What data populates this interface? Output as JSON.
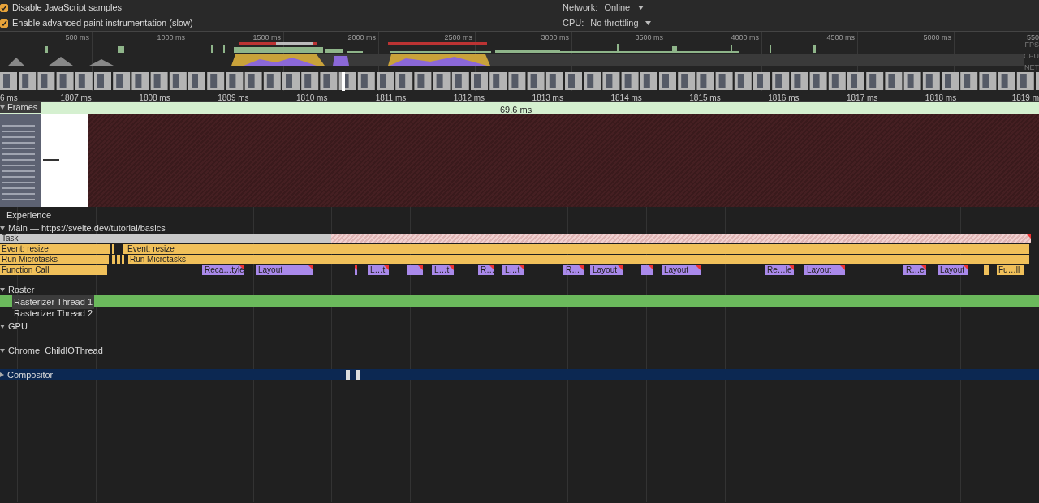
{
  "settings": {
    "checkboxes": [
      {
        "label": "Disable JavaScript samples",
        "checked": true
      },
      {
        "label": "Enable advanced paint instrumentation (slow)",
        "checked": true
      }
    ],
    "dropdowns": [
      {
        "label": "Network:",
        "value": "Online"
      },
      {
        "label": "CPU:",
        "value": "No throttling"
      }
    ]
  },
  "overview": {
    "ticks": [
      "500 ms",
      "1000 ms",
      "1500 ms",
      "2000 ms",
      "2500 ms",
      "3000 ms",
      "3500 ms",
      "4000 ms",
      "4500 ms",
      "5000 ms",
      "550"
    ],
    "lanes": [
      "FPS",
      "CPU",
      "NET"
    ]
  },
  "ruler": [
    "6 ms",
    "1807 ms",
    "1808 ms",
    "1809 ms",
    "1810 ms",
    "1811 ms",
    "1812 ms",
    "1813 ms",
    "1814 ms",
    "1815 ms",
    "1816 ms",
    "1817 ms",
    "1818 ms",
    "1819 m"
  ],
  "frames": {
    "label": "Frames",
    "expanded": true,
    "duration": "69.6 ms"
  },
  "experience": {
    "label": "Experience"
  },
  "main": {
    "label": "Main — https://svelte.dev/tutorial/basics",
    "expanded": true,
    "rows": [
      {
        "events": [
          {
            "kind": "task",
            "label": "Task"
          },
          {
            "kind": "idle",
            "warning": true
          }
        ]
      },
      {
        "events": [
          {
            "kind": "event",
            "label": "Event: resize"
          },
          {
            "kind": "event"
          },
          {
            "kind": "event"
          },
          {
            "kind": "event",
            "label": "Event: resize"
          }
        ]
      },
      {
        "events": [
          {
            "kind": "event",
            "label": "Run Microtasks"
          },
          {
            "kind": "event"
          },
          {
            "kind": "event"
          },
          {
            "kind": "event"
          },
          {
            "kind": "event",
            "label": "Run Microtasks"
          }
        ]
      },
      {
        "events": [
          {
            "kind": "event",
            "label": "Function Call"
          },
          {
            "kind": "layout",
            "label": "Reca…tyle",
            "warning": true
          },
          {
            "kind": "layout",
            "label": "Layout",
            "warning": true
          },
          {
            "kind": "layout",
            "warning": true
          },
          {
            "kind": "layout",
            "label": "L…t",
            "warning": true
          },
          {
            "kind": "layout",
            "warning": true
          },
          {
            "kind": "layout",
            "label": "L…t",
            "warning": true
          },
          {
            "kind": "layout",
            "label": "R…",
            "warning": true
          },
          {
            "kind": "layout",
            "label": "L…t",
            "warning": true
          },
          {
            "kind": "layout",
            "label": "R…",
            "warning": true
          },
          {
            "kind": "layout",
            "label": "Layout",
            "warning": true
          },
          {
            "kind": "layout",
            "warning": true
          },
          {
            "kind": "layout",
            "label": "Layout",
            "warning": true
          },
          {
            "kind": "layout",
            "label": "Re…le",
            "warning": true
          },
          {
            "kind": "layout",
            "label": "Layout",
            "warning": true
          },
          {
            "kind": "layout",
            "label": "R…e",
            "warning": true
          },
          {
            "kind": "layout",
            "label": "Layout",
            "warning": true
          },
          {
            "kind": "event"
          },
          {
            "kind": "event",
            "label": "Fu…ll"
          }
        ]
      }
    ]
  },
  "raster": {
    "label": "Raster",
    "expanded": true,
    "threads": [
      {
        "label": "Rasterizer Thread 1",
        "selected": true
      },
      {
        "label": "Rasterizer Thread 2",
        "selected": false
      }
    ]
  },
  "gpu": {
    "label": "GPU",
    "expanded": true
  },
  "io": {
    "label": "Chrome_ChildIOThread",
    "expanded": true
  },
  "compositor": {
    "label": "Compositor",
    "expanded": false,
    "selected": true
  }
}
